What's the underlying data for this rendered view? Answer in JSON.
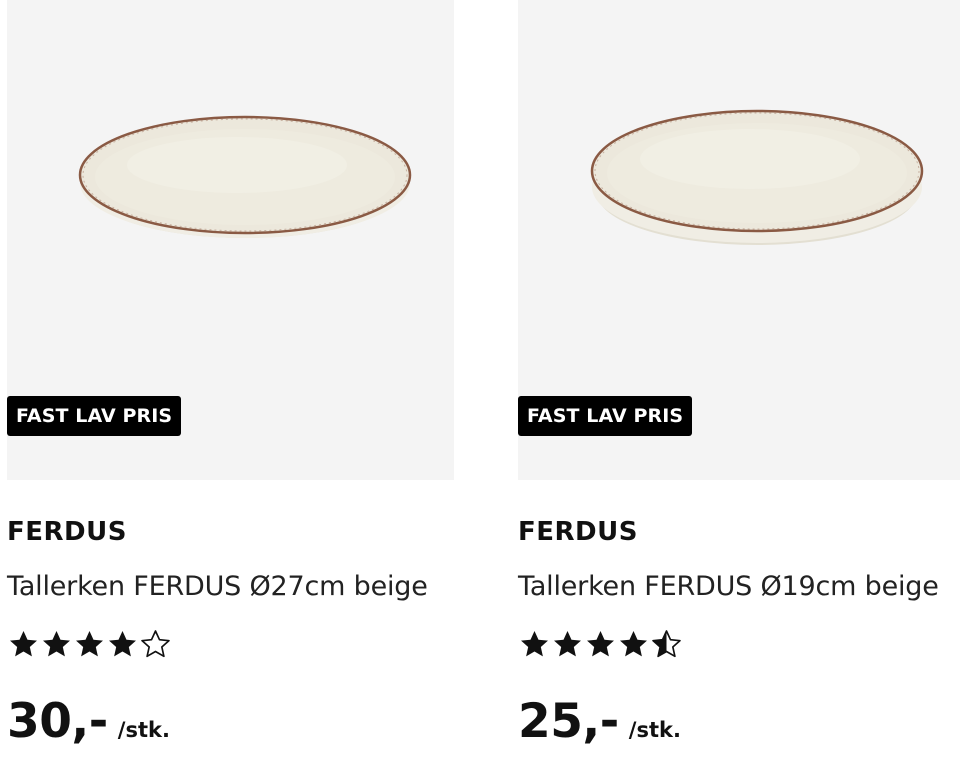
{
  "products": [
    {
      "badge": "FAST LAV PRIS",
      "brand": "FERDUS",
      "title": "Tallerken FERDUS Ø27cm beige",
      "rating": 4.0,
      "price": "30,-",
      "unit": "/stk.",
      "image": "plate-image"
    },
    {
      "badge": "FAST LAV PRIS",
      "brand": "FERDUS",
      "title": "Tallerken FERDUS Ø19cm beige",
      "rating": 4.5,
      "price": "25,-",
      "unit": "/stk.",
      "image": "plate-image"
    }
  ],
  "colors": {
    "image_bg": "#f4f4f4",
    "badge_bg": "#000000",
    "badge_text": "#ffffff",
    "plate_rim": "#8a5a44",
    "plate_body": "#ece8dc"
  }
}
